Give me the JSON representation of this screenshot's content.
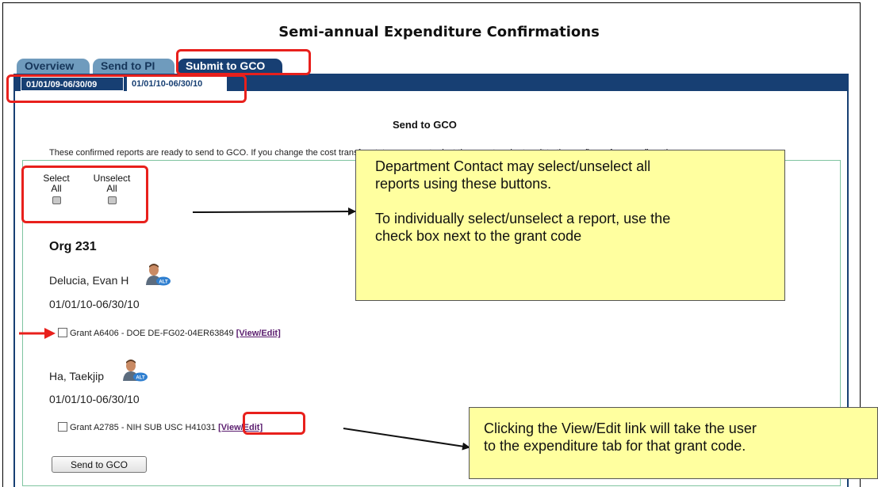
{
  "page": {
    "title": "Semi-annual Expenditure Confirmations"
  },
  "tabs": [
    {
      "label": "Overview",
      "active": false
    },
    {
      "label": "Send to PI",
      "active": false
    },
    {
      "label": "Submit to GCO",
      "active": true
    }
  ],
  "period_tabs": [
    {
      "label": "01/01/09-06/30/09",
      "selected": true
    },
    {
      "label": "01/01/10-06/30/10",
      "selected": false
    }
  ],
  "section": {
    "title": "Send to GCO",
    "info_text": "These confirmed reports are ready to send to GCO. If you change the cost transfer status you must reject the report and return it to the confirmer for reconfirmation."
  },
  "selection_buttons": {
    "select_all_line1": "Select",
    "select_all_line2": "All",
    "unselect_all_line1": "Unselect",
    "unselect_all_line2": "All"
  },
  "org": {
    "name": "Org 231"
  },
  "people": [
    {
      "name": "Delucia, Evan H",
      "badge": "ALT",
      "period": "01/01/10-06/30/10",
      "grant_text": "Grant A6406 - DOE DE-FG02-04ER63849",
      "link_label": "[View/Edit]"
    },
    {
      "name": "Ha, Taekjip",
      "badge": "ALT",
      "period": "01/01/10-06/30/10",
      "grant_text": "Grant A2785 - NIH SUB USC H41031",
      "link_label": "[View/Edit]"
    }
  ],
  "actions": {
    "send_label": "Send to GCO"
  },
  "annotations": {
    "callout_select": {
      "line1": "Department Contact may select/unselect all",
      "line2": "reports using these buttons.",
      "line3": "To individually select/unselect a report, use the",
      "line4": "check box next to the grant code"
    },
    "callout_view": {
      "line1": "Clicking  the View/Edit link will take the user",
      "line2": "to the expenditure tab for that grant code."
    }
  },
  "colors": {
    "tab_active": "#173f73",
    "tab_inactive": "#6f9bbd",
    "callout_bg": "#ffff9f",
    "highlight_red": "#e8201c",
    "content_border_green": "#7fc4a0",
    "link_purple": "#5a1c6e"
  }
}
